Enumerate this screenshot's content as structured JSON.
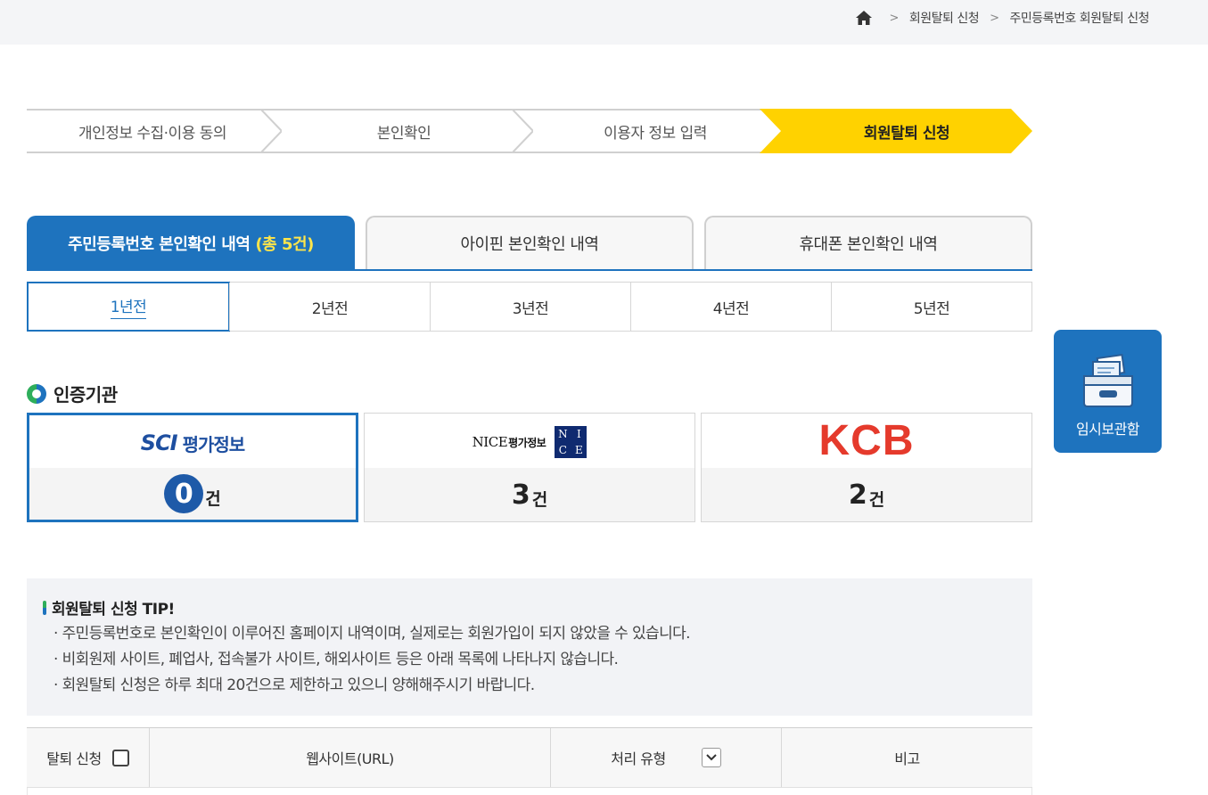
{
  "breadcrumb": {
    "home_icon": "home-icon",
    "items": [
      "회원탈퇴 신청",
      "주민등록번호 회원탈퇴 신청"
    ]
  },
  "steps": [
    {
      "label": "개인정보 수집·이용 동의",
      "active": false
    },
    {
      "label": "본인확인",
      "active": false
    },
    {
      "label": "이용자 정보 입력",
      "active": false
    },
    {
      "label": "회원탈퇴 신청",
      "active": true
    }
  ],
  "main_tabs": [
    {
      "label": "주민등록번호 본인확인 내역",
      "count": "(총 5건)",
      "active": true
    },
    {
      "label": "아이핀 본인확인 내역",
      "active": false
    },
    {
      "label": "휴대폰 본인확인 내역",
      "active": false
    }
  ],
  "year_tabs": [
    {
      "label": "1년전",
      "active": true
    },
    {
      "label": "2년전",
      "active": false
    },
    {
      "label": "3년전",
      "active": false
    },
    {
      "label": "4년전",
      "active": false
    },
    {
      "label": "5년전",
      "active": false
    }
  ],
  "agency_section": {
    "title": "인증기관",
    "cards": [
      {
        "logo_text": "SCI",
        "logo_sub": "평가정보",
        "count": "0",
        "unit": "건",
        "active": true
      },
      {
        "logo_text": "NICE",
        "logo_sub": "평가정보",
        "badge": [
          "N",
          "I",
          "C",
          "E"
        ],
        "count": "3",
        "unit": "건",
        "active": false
      },
      {
        "logo_text": "KCB",
        "count": "2",
        "unit": "건",
        "active": false
      }
    ]
  },
  "side_widget": {
    "icon": "drawer-icon",
    "label": "임시보관함"
  },
  "tip": {
    "title": "회원탈퇴 신청 TIP!",
    "lines": [
      "· 주민등록번호로 본인확인이 이루어진 홈페이지 내역이며, 실제로는 회원가입이 되지 않았을 수 있습니다.",
      "· 비회원제 사이트, 폐업사, 접속불가 사이트, 해외사이트 등은 아래 목록에 나타나지 않습니다.",
      "· 회원탈퇴 신청은 하루 최대 20건으로 제한하고 있으니 양해해주시기 바랍니다."
    ]
  },
  "table": {
    "columns": [
      "탈퇴 신청",
      "웹사이트(URL)",
      "처리 유형",
      "비고"
    ]
  },
  "colors": {
    "primary": "#1e73be",
    "active_step": "#ffd200",
    "highlight_count": "#ffe54a"
  }
}
